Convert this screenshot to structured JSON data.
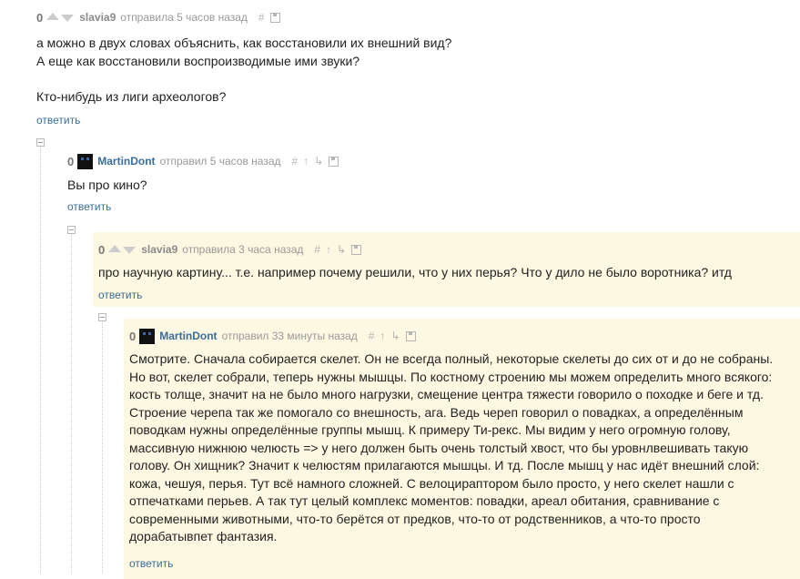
{
  "comments": [
    {
      "score": "0",
      "user": "slavia9",
      "action": "отправила 5 часов назад",
      "icons": [
        "hash-icon",
        "save-icon"
      ],
      "lines": [
        "а можно в двух словах объяснить, как восстановили их внешний вид?",
        "А еще как восстановили воспроизводимые ими звуки?",
        "",
        "Кто-нибудь из лиги археологов?"
      ],
      "reply": "ответить"
    },
    {
      "score": "0",
      "user": "MartinDont",
      "action": "отправил 5 часов назад",
      "icons": [
        "hash-icon",
        "parent-arrow-icon",
        "thread-icon",
        "save-icon"
      ],
      "lines": [
        "Вы про кино?"
      ],
      "reply": "ответить"
    },
    {
      "score": "0",
      "user": "slavia9",
      "action": "отправила 3 часа назад",
      "icons": [
        "hash-icon",
        "parent-arrow-icon",
        "thread-icon",
        "save-icon"
      ],
      "lines": [
        "про научную картину... т.е. например почему решили, что у них перья? Что у дило не было воротника? итд"
      ],
      "reply": "ответить"
    },
    {
      "score": "0",
      "user": "MartinDont",
      "action": "отправил 33 минуты назад",
      "icons": [
        "hash-icon",
        "parent-arrow-icon",
        "thread-icon",
        "save-icon"
      ],
      "lines": [
        "Смотрите. Сначала собирается скелет. Он не всегда полный, некоторые скелеты до сих от и до не собраны.",
        "Но вот, скелет собрали, теперь нужны мышцы. По костному строению мы можем определить много всякого:",
        "кость толще, значит на не было много нагрузки, смещение центра тяжести говорило о походке и беге и тд.",
        "Строение черепа так же помогало со внешность, ага. Ведь череп говорил о повадках, а определённым",
        "поводкам нужны определённые группы мышц. К примеру Ти-рекс. Мы видим у него огромную голову,",
        "массивную нижнюю челюсть => у него должен быть очень толстый хвост, что бы уровнлвешивать такую",
        "голову. Он хищник? Значит к челюстям прилагаются мышцы. И тд. После мышц у нас идёт внешний слой:",
        "кожа, чешуя, перья. Тут всё намного сложней. С велоцираптором было просто, у него скелет нашли с",
        "отпечатками перьев. А так тут целый комплекс моментов: повадки, ареал обитания, сравнивание с",
        "современными животными, что-то берётся от предков, что-то от родственников, а что-то просто",
        "дорабатывпет фантазия."
      ],
      "reply": "ответить"
    }
  ],
  "colors": {
    "highlight": "#fcf8e1",
    "link": "#3a6d99",
    "meta": "#999999"
  }
}
